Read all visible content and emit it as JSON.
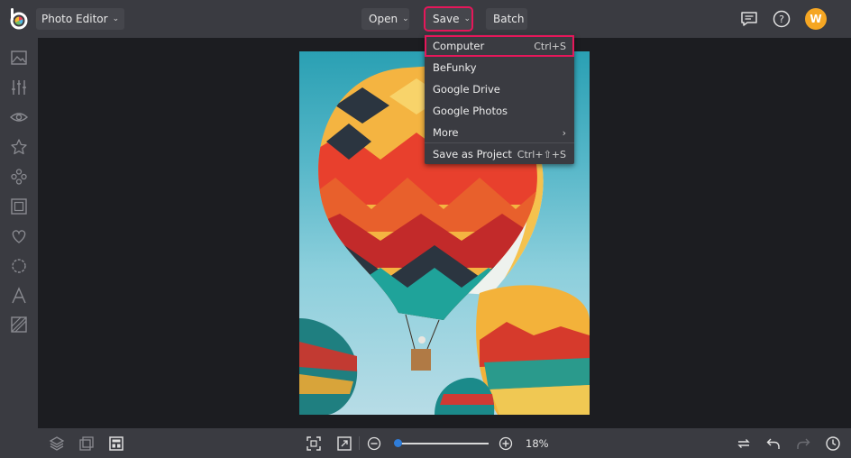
{
  "topbar": {
    "app_title": "Photo Editor",
    "open_label": "Open",
    "save_label": "Save",
    "batch_label": "Batch",
    "avatar_initial": "W"
  },
  "save_menu": {
    "items": [
      {
        "label": "Computer",
        "shortcut": "Ctrl+S"
      },
      {
        "label": "BeFunky",
        "shortcut": ""
      },
      {
        "label": "Google Drive",
        "shortcut": ""
      },
      {
        "label": "Google Photos",
        "shortcut": ""
      },
      {
        "label": "More",
        "shortcut": ""
      },
      {
        "label": "Save as Project",
        "shortcut": "Ctrl+⇧+S"
      }
    ]
  },
  "bottombar": {
    "zoom_label": "18%",
    "zoom_value": 18
  },
  "colors": {
    "accent": "#e5175a",
    "slider": "#2f7dd9",
    "avatar": "#f5a623",
    "bar_bg": "#3a3b41"
  },
  "icons": {
    "sidebar": [
      "image-icon",
      "sliders-icon",
      "eye-icon",
      "star-icon",
      "effects-icon",
      "frame-icon",
      "heart-icon",
      "texture-icon",
      "text-icon",
      "graphics-icon"
    ],
    "topbar_right": [
      "chat-icon",
      "help-icon"
    ]
  }
}
